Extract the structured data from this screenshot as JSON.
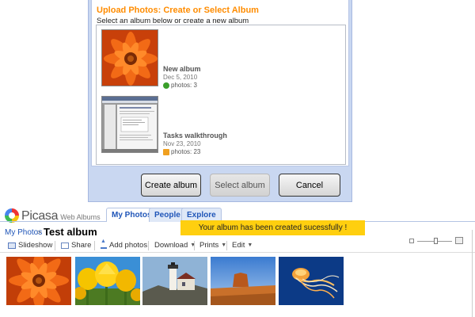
{
  "dialog": {
    "title": "Upload Photos: Create or Select Album",
    "subtitle": "Select an album below or create a new album",
    "albums": [
      {
        "name": "New album",
        "date": "Dec 5, 2010",
        "count": "photos: 3"
      },
      {
        "name": "Tasks walkthrough",
        "date": "Nov 23, 2010",
        "count": "photos: 23"
      }
    ],
    "buttons": {
      "create": "Create album",
      "select": "Select album",
      "cancel": "Cancel"
    }
  },
  "header": {
    "logo": "Picasa",
    "logo_sub": "Web Albums",
    "tabs": [
      {
        "label": "My Photos",
        "active": true
      },
      {
        "label": "People",
        "active": false
      },
      {
        "label": "Explore",
        "active": false
      }
    ]
  },
  "notice": "Your album has been created sucessfully !",
  "breadcrumb": {
    "root": "My Photos",
    "sep": ">",
    "title": "Test album"
  },
  "toolbar": {
    "slideshow": "Slideshow",
    "share": "Share",
    "add_photos": "Add photos",
    "download": "Download",
    "prints": "Prints",
    "edit": "Edit"
  },
  "colors": {
    "accent_orange": "#ff8c00",
    "link_blue": "#1f55b8",
    "notice_yellow": "#ffcf0f",
    "dialog_frame": "#c9d7f1"
  }
}
